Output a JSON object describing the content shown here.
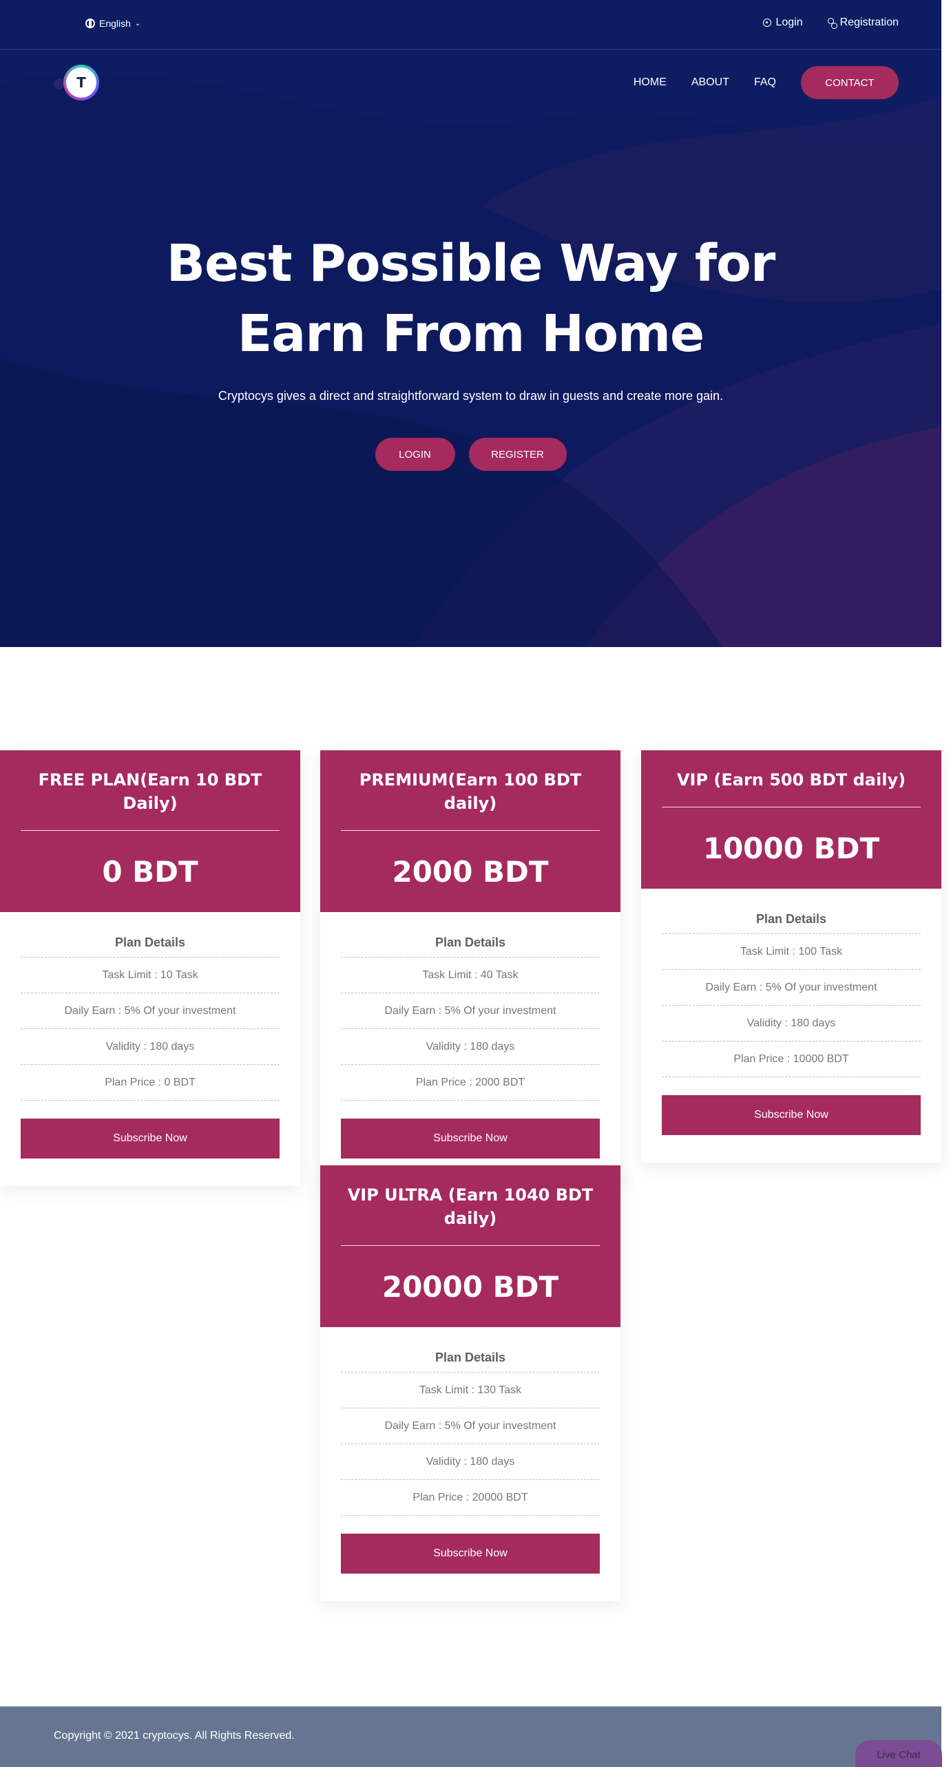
{
  "topbar": {
    "language": "English",
    "login": "Login",
    "registration": "Registration"
  },
  "nav": {
    "logo_letter": "T",
    "items": [
      "HOME",
      "ABOUT",
      "FAQ"
    ],
    "contact": "CONTACT"
  },
  "hero": {
    "title_line1": "Best Possible Way for",
    "title_line2": "Earn From Home",
    "subtitle": "Cryptocys gives a direct and straightforward system to draw in guests and create more gain.",
    "login_button": "LOGIN",
    "register_button": "REGISTER"
  },
  "plans": [
    {
      "name": "FREE PLAN(Earn 10 BDT Daily)",
      "price": "0 BDT",
      "details_title": "Plan Details",
      "rows": [
        "Task Limit : 10 Task",
        "Daily Earn : 5% Of your investment",
        "Validity : 180 days",
        "Plan Price : 0 BDT"
      ],
      "button": "Subscribe Now"
    },
    {
      "name": "PREMIUM(Earn 100 BDT daily)",
      "price": "2000 BDT",
      "details_title": "Plan Details",
      "rows": [
        "Task Limit : 40 Task",
        "Daily Earn : 5% Of your investment",
        "Validity : 180 days",
        "Plan Price : 2000 BDT"
      ],
      "button": "Subscribe Now"
    },
    {
      "name": "VIP (Earn 500 BDT daily)",
      "price": "10000 BDT",
      "details_title": "Plan Details",
      "rows": [
        "Task Limit : 100 Task",
        "Daily Earn : 5% Of your investment",
        "Validity : 180 days",
        "Plan Price : 10000 BDT"
      ],
      "button": "Subscribe Now"
    },
    {
      "name": "VIP ULTRA (Earn 1040 BDT daily)",
      "price": "20000 BDT",
      "details_title": "Plan Details",
      "rows": [
        "Task Limit : 130 Task",
        "Daily Earn : 5% Of your investment",
        "Validity : 180 days",
        "Plan Price : 20000 BDT"
      ],
      "button": "Subscribe Now"
    }
  ],
  "footer": {
    "copyright": "Copyright © 2021 cryptocys. All Rights Reserved.",
    "live_chat": "Live Chat"
  },
  "colors": {
    "hero_bg": "#0d1b5e",
    "accent": "#a52a5e",
    "footer_bg": "#667591"
  }
}
